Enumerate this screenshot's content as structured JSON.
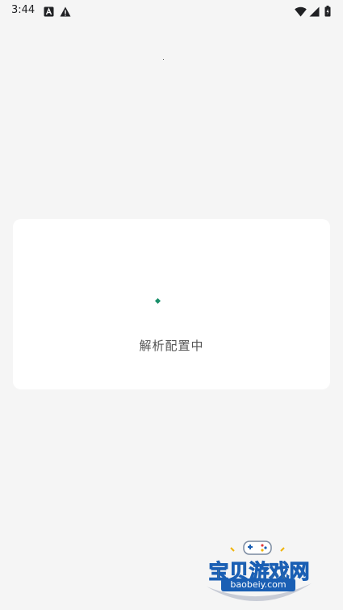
{
  "status_bar": {
    "time": "3:44",
    "left_icons": [
      "a-box-icon",
      "warning-icon"
    ],
    "right_icons": [
      "wifi-icon",
      "signal-icon",
      "battery-icon"
    ]
  },
  "loading": {
    "message": "解析配置中",
    "spinner_color": "#1a8f6a"
  },
  "watermark": {
    "site_name": "宝贝游戏网",
    "url": "baobeiy.com"
  }
}
